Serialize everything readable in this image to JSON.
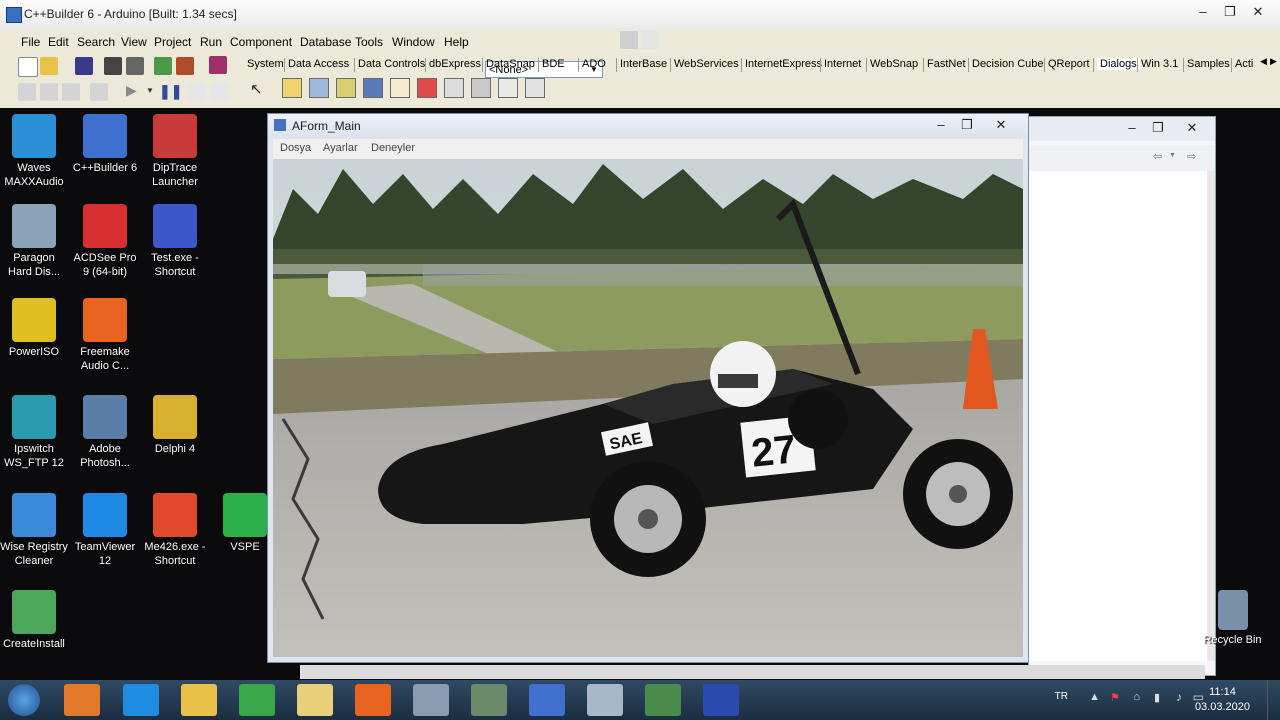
{
  "ide": {
    "title": "C++Builder 6 - Arduino [Built: 1.34 secs]",
    "menu": [
      "File",
      "Edit",
      "Search",
      "View",
      "Project",
      "Run",
      "Component",
      "Database",
      "Tools",
      "Window",
      "Help"
    ],
    "combo_value": "<None>",
    "palette_tabs": [
      "System",
      "Data Access",
      "Data Controls",
      "dbExpress",
      "DataSnap",
      "BDE",
      "ADO",
      "InterBase",
      "WebServices",
      "InternetExpress",
      "Internet",
      "WebSnap",
      "FastNet",
      "Decision Cube",
      "QReport",
      "Dialogs",
      "Win 3.1",
      "Samples",
      "Acti"
    ],
    "active_tab": "Dialogs"
  },
  "desktop_icons": [
    {
      "label1": "Waves",
      "label2": "MAXXAudio",
      "color": "#2b8fd6"
    },
    {
      "label1": "C++Builder 6",
      "label2": "",
      "color": "#3f6fcf"
    },
    {
      "label1": "DipTrace",
      "label2": "Launcher",
      "color": "#c83a3a"
    },
    {
      "label1": "Paragon",
      "label2": "Hard Dis...",
      "color": "#8aa3b8"
    },
    {
      "label1": "ACDSee Pro",
      "label2": "9 (64-bit)",
      "color": "#d83030"
    },
    {
      "label1": "Test.exe -",
      "label2": "Shortcut",
      "color": "#3b57c9"
    },
    {
      "label1": "PowerISO",
      "label2": "",
      "color": "#e0c020"
    },
    {
      "label1": "Freemake",
      "label2": "Audio C...",
      "color": "#e8641e"
    },
    {
      "label1": "Ipswitch",
      "label2": "WS_FTP 12",
      "color": "#2a9ab0"
    },
    {
      "label1": "Adobe",
      "label2": "Photosh...",
      "color": "#5a7ea8"
    },
    {
      "label1": "Delphi 4",
      "label2": "",
      "color": "#d8b030"
    },
    {
      "label1": "Wise Registry",
      "label2": "Cleaner",
      "color": "#3b8ad8"
    },
    {
      "label1": "TeamViewer",
      "label2": "12",
      "color": "#1e88e5"
    },
    {
      "label1": "Me426.exe -",
      "label2": "Shortcut",
      "color": "#e04a2a"
    },
    {
      "label1": "VSPE",
      "label2": "",
      "color": "#2bb04a"
    },
    {
      "label1": "CreateInstall",
      "label2": "",
      "color": "#4aa85a"
    },
    {
      "label1": "Recycle Bin",
      "label2": "",
      "color": "#7a8fa8"
    }
  ],
  "aform": {
    "title": "AForm_Main",
    "menu": [
      "Dosya",
      "Ayarlar",
      "Deneyler"
    ]
  },
  "car": {
    "number": "27",
    "sponsor": "SAE"
  },
  "taskbar": {
    "lang": "TR",
    "time": "11:14",
    "date": "03.03.2020"
  }
}
